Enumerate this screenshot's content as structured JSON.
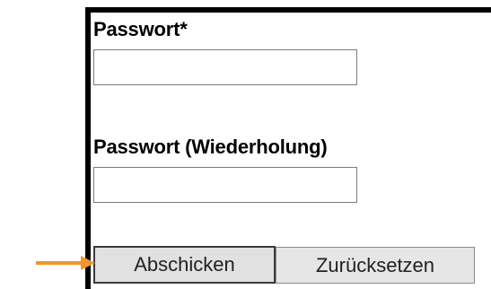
{
  "form": {
    "password_label": "Passwort*",
    "password_value": "",
    "password_repeat_label": "Passwort (Wiederholung)",
    "password_repeat_value": "",
    "submit_label": "Abschicken",
    "reset_label": "Zurücksetzen"
  },
  "annotation": {
    "arrow_color": "#f0962d",
    "arrow_icon": "arrow-right-icon"
  }
}
